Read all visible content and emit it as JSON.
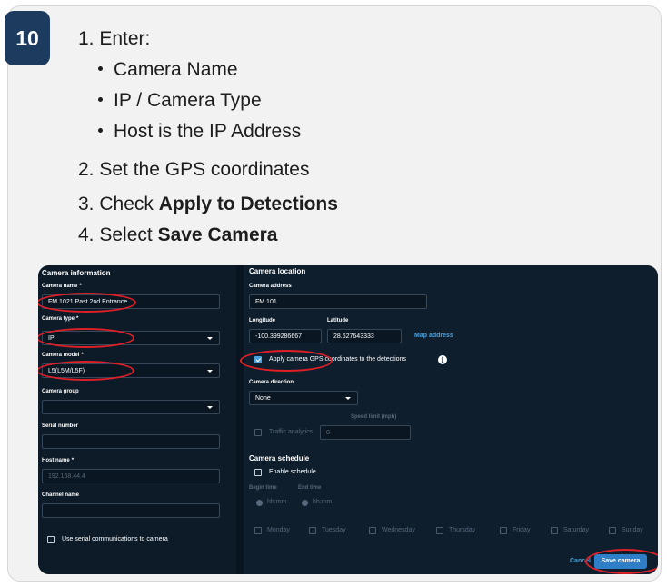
{
  "step": {
    "number": "10"
  },
  "instructions": {
    "step1": "1. Enter:",
    "bullets": [
      "Camera Name",
      "IP / Camera Type",
      "Host is the IP Address"
    ],
    "step2": "2. Set the GPS coordinates",
    "step3_prefix": "3. Check ",
    "step3_bold": "Apply to Detections",
    "step4_prefix": "4. Select ",
    "step4_bold": "Save Camera"
  },
  "screenshot": {
    "left": {
      "section_title": "Camera information",
      "camera_name_label": "Camera name",
      "camera_name_value": "FM 1021 Past 2nd Entrance",
      "camera_type_label": "Camera type",
      "camera_type_value": "IP",
      "camera_model_label": "Camera model",
      "camera_model_value": "L5(L5M/L5F)",
      "camera_group_label": "Camera group",
      "camera_group_value": "",
      "serial_label": "Serial number",
      "serial_value": "",
      "host_label": "Host name",
      "host_value": "192.168.44.4",
      "channel_label": "Channel name",
      "channel_value": "",
      "serial_comm_label": "Use serial communications to camera",
      "required_mark": "*"
    },
    "right": {
      "section_title": "Camera location",
      "address_label": "Camera address",
      "address_value": "FM 101",
      "longitude_label": "Longitude",
      "longitude_value": "-100.399286667",
      "latitude_label": "Latitude",
      "latitude_value": "28.627643333",
      "map_address": "Map address",
      "apply_gps_label": "Apply camera GPS coordinates to the detections",
      "info_glyph": "i",
      "direction_label": "Camera direction",
      "direction_value": "None",
      "speed_limit_label": "Speed limit (mph)",
      "traffic_analytics_label": "Traffic analytics",
      "speed_limit_value": "0",
      "schedule_title": "Camera schedule",
      "enable_schedule_label": "Enable schedule",
      "begin_time_label": "Begin time",
      "end_time_label": "End time",
      "begin_time_value": "hh:mm",
      "end_time_value": "hh:mm",
      "days": [
        "Monday",
        "Tuesday",
        "Wednesday",
        "Thursday",
        "Friday",
        "Saturday",
        "Sunday"
      ],
      "cancel_label": "Cancel",
      "save_label": "Save camera"
    }
  },
  "colors": {
    "badge": "#1d3a5f",
    "highlight": "#e01f26",
    "panel": "#0c1a27",
    "accent": "#4aa3df",
    "save_button": "#2f7fc8"
  }
}
